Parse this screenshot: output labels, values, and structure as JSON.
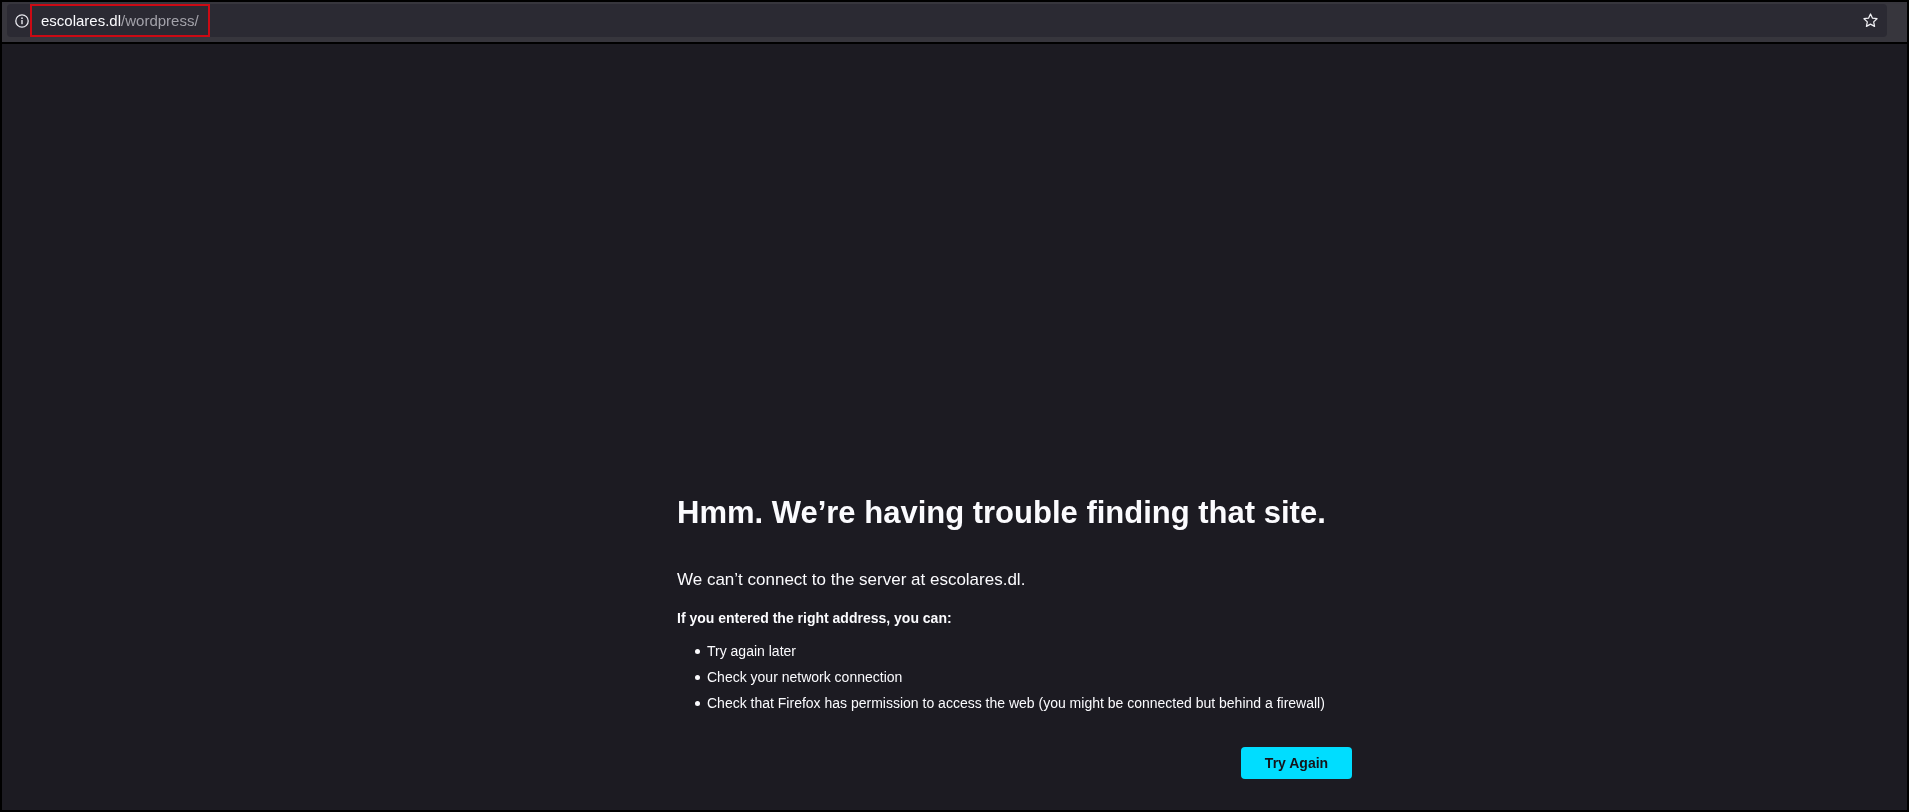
{
  "toolbar": {
    "url": {
      "host": "escolares.dl",
      "path": "/wordpress/",
      "highlighted": true
    }
  },
  "error": {
    "title": "Hmm. We’re having trouble finding that site.",
    "message": "We can’t connect to the server at escolares.dl.",
    "advice_heading": "If you entered the right address, you can:",
    "suggestions": [
      "Try again later",
      "Check your network connection",
      "Check that Firefox has permission to access the web (you might be connected but behind a firewall)"
    ],
    "button": "Try Again"
  }
}
